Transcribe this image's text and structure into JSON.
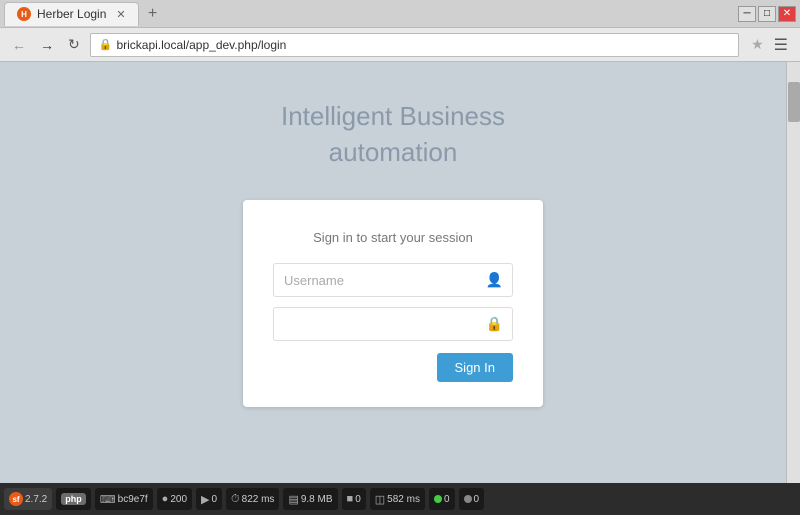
{
  "browser": {
    "tab_title": "Herber Login",
    "tab_favicon": "H",
    "url": "brickapi.local/app_dev.php/login",
    "window_controls": {
      "minimize": "─",
      "maximize": "□",
      "close": "✕"
    }
  },
  "page": {
    "headline_line1": "Intelligent Business",
    "headline_line2": "automation",
    "login_card": {
      "subtitle": "Sign in to start your session",
      "username_placeholder": "Username",
      "password_placeholder": "",
      "signin_label": "Sign In"
    }
  },
  "statusbar": {
    "sf_version": "2.7.2",
    "php_label": "php",
    "count1": "bc9e7f",
    "count2": "200",
    "count3": "0",
    "time1": "822 ms",
    "memory": "9.8 MB",
    "count4": "0",
    "time2": "582 ms",
    "count5": "0",
    "count6": "0"
  }
}
